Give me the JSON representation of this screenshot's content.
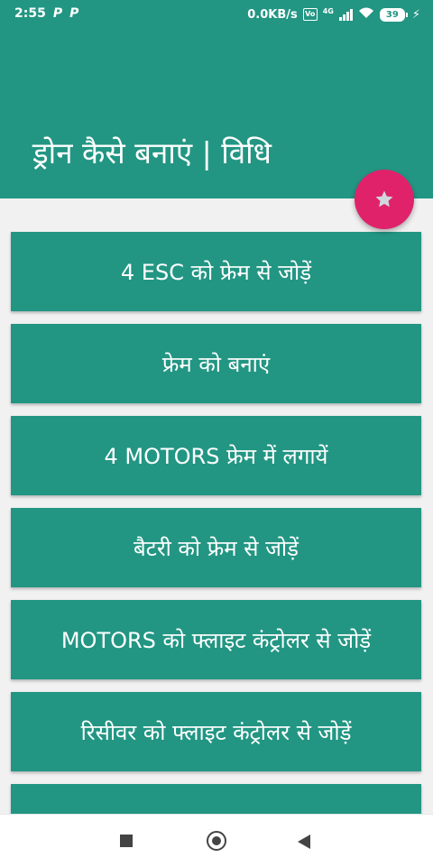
{
  "status_bar": {
    "time": "2:55",
    "notif_icons": [
      "P",
      "P"
    ],
    "network_speed": "0.0KB/s",
    "vo_label": "Vo",
    "lte_label": "4G",
    "battery": "39"
  },
  "app_bar": {
    "title": "ड्रोन कैसे बनाएं | विधि",
    "color": "#229683"
  },
  "fab": {
    "icon": "star-icon",
    "color": "#e0226b"
  },
  "items": [
    {
      "label": "4 ESC को फ्रेम से जोड़ें"
    },
    {
      "label": "फ्रेम को बनाएं"
    },
    {
      "label": "4 MOTORS फ्रेम में लगायें"
    },
    {
      "label": "बैटरी को फ्रेम से जोड़ें"
    },
    {
      "label": "MOTORS को फ्लाइट कंट्रोलर से जोड़ें"
    },
    {
      "label": "रिसीवर को फ्लाइट कंट्रोलर से जोड़ें"
    },
    {
      "label": ""
    }
  ]
}
